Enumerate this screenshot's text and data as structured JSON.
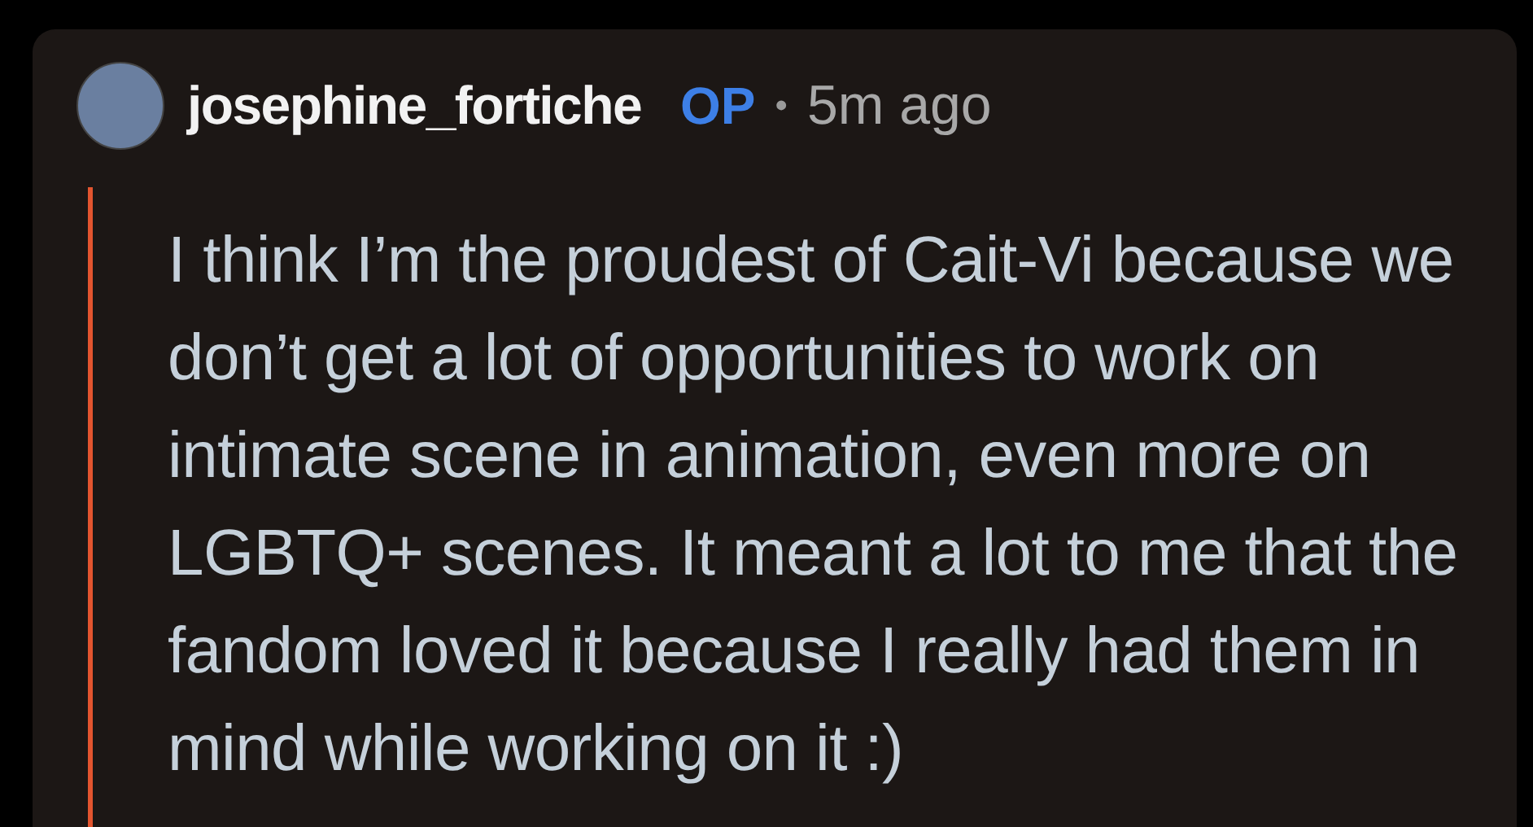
{
  "comment": {
    "author": "josephine_fortiche",
    "badge": "OP",
    "separator": "•",
    "time": "5m ago",
    "body": "I think I’m the proudest of Cait-Vi because we don’t get a lot of opportunities to work on intimate scene in animation, even more on LGBTQ+ scenes. It meant a lot to me that the fandom loved it because I really had them in mind while working on it :)"
  }
}
